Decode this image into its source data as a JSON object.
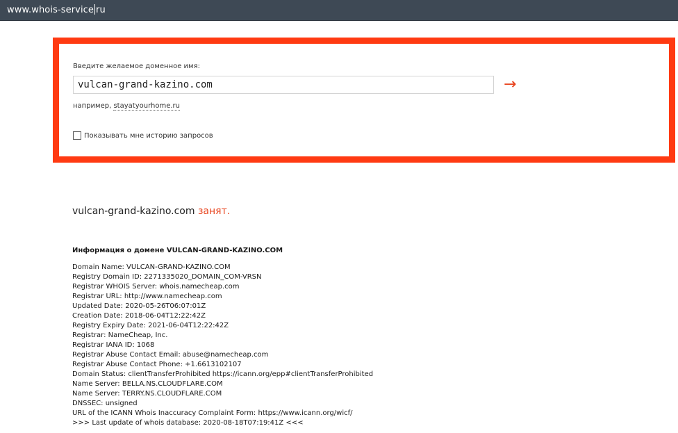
{
  "browser": {
    "url_before_caret": "www.whois-service",
    "url_after_caret": "ru"
  },
  "search": {
    "prompt": "Введите желаемое доменное имя:",
    "input_value": "vulcan-grand-kazino.com",
    "submit_icon": "→",
    "example_prefix": "например,",
    "example_link": "stayatyourhome.ru",
    "history_checked": false,
    "history_label": "Показывать мне историю запросов"
  },
  "result": {
    "domain": "vulcan-grand-kazino.com",
    "status": "занят."
  },
  "info": {
    "title": "Информация о домене VULCAN-GRAND-KAZINO.COM",
    "lines": [
      "Domain Name: VULCAN-GRAND-KAZINO.COM",
      "Registry Domain ID: 2271335020_DOMAIN_COM-VRSN",
      "Registrar WHOIS Server: whois.namecheap.com",
      "Registrar URL: http://www.namecheap.com",
      "Updated Date: 2020-05-26T06:07:01Z",
      "Creation Date: 2018-06-04T12:22:42Z",
      "Registry Expiry Date: 2021-06-04T12:22:42Z",
      "Registrar: NameCheap, Inc.",
      "Registrar IANA ID: 1068",
      "Registrar Abuse Contact Email: abuse@namecheap.com",
      "Registrar Abuse Contact Phone: +1.6613102107",
      "Domain Status: clientTransferProhibited https://icann.org/epp#clientTransferProhibited",
      "Name Server: BELLA.NS.CLOUDFLARE.COM",
      "Name Server: TERRY.NS.CLOUDFLARE.COM",
      "DNSSEC: unsigned",
      "URL of the ICANN Whois Inaccuracy Complaint Form: https://www.icann.org/wicf/",
      ">>> Last update of whois database: 2020-08-18T07:19:41Z <<<"
    ]
  },
  "colors": {
    "accent": "#ff3a12",
    "status_red": "#e8431d",
    "address_bar": "#3e4955"
  }
}
